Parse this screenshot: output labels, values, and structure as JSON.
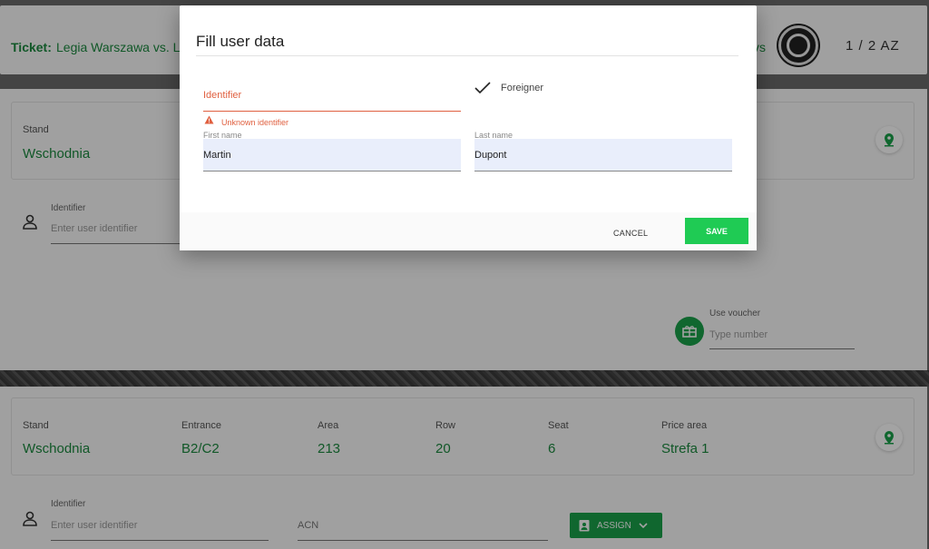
{
  "ticket": {
    "label": "Ticket:",
    "match": "Legia Warszawa vs. L",
    "vs_tail": "vs",
    "page_counter": "1 / 2 AZ"
  },
  "seat1": {
    "stand_label": "Stand",
    "stand_value": "Wschodnia"
  },
  "holder1": {
    "identifier_label": "Identifier",
    "identifier_placeholder": "Enter user identifier"
  },
  "voucher": {
    "label": "Use voucher",
    "placeholder": "Type number"
  },
  "seat2": {
    "stand_label": "Stand",
    "stand_value": "Wschodnia",
    "entrance_label": "Entrance",
    "entrance_value": "B2/C2",
    "area_label": "Area",
    "area_value": "213",
    "row_label": "Row",
    "row_value": "20",
    "seat_label": "Seat",
    "seat_value": "6",
    "price_label": "Price area",
    "price_value": "Strefa 1"
  },
  "holder2": {
    "identifier_label": "Identifier",
    "identifier_placeholder": "Enter user identifier",
    "acn_placeholder": "ACN",
    "assign_label": "ASSIGN"
  },
  "modal": {
    "title": "Fill user data",
    "identifier_label": "Identifier",
    "error_message": "Unknown identifier",
    "foreigner_label": "Foreigner",
    "first_name_label": "First name",
    "first_name_value": "Martin",
    "last_name_label": "Last name",
    "last_name_value": "Dupont",
    "cancel_label": "CANCEL",
    "save_label": "SAVE"
  },
  "colors": {
    "accent_green": "#1aa14a",
    "save_green": "#1fcb54",
    "error_red": "#e06040"
  }
}
